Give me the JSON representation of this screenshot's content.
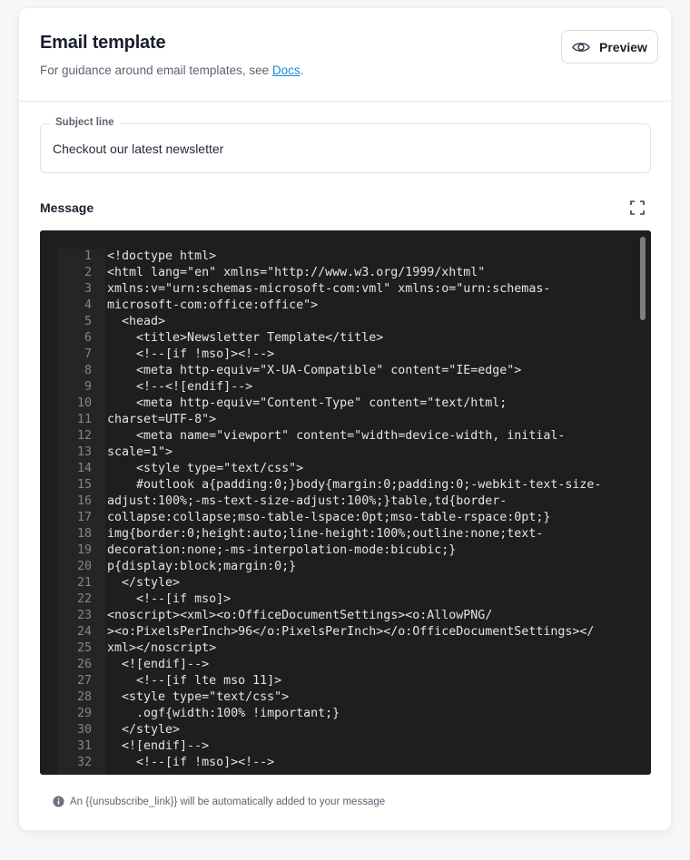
{
  "header": {
    "title": "Email template",
    "subtitle_prefix": "For guidance around email templates, see ",
    "docs_link": "Docs",
    "subtitle_suffix": "."
  },
  "preview_button": {
    "label": "Preview",
    "icon": "eye-icon"
  },
  "subject": {
    "label": "Subject line",
    "value": "Checkout our latest newsletter"
  },
  "message": {
    "label": "Message",
    "expand_icon": "expand-icon"
  },
  "editor": {
    "lines": [
      {
        "n": "1",
        "t": "<!doctype html>"
      },
      {
        "n": "2",
        "t": "<html lang=\"en\" xmlns=\"http://www.w3.org/1999/xhtml\""
      },
      {
        "n": "3",
        "t": "xmlns:v=\"urn:schemas-microsoft-com:vml\" xmlns:o=\"urn:schemas-"
      },
      {
        "n": "4",
        "t": "microsoft-com:office:office\">"
      },
      {
        "n": "5",
        "t": "  <head>"
      },
      {
        "n": "6",
        "t": "    <title>Newsletter Template</title>"
      },
      {
        "n": "7",
        "t": "    <!--[if !mso]><!-->"
      },
      {
        "n": "8",
        "t": "    <meta http-equiv=\"X-UA-Compatible\" content=\"IE=edge\">"
      },
      {
        "n": "9",
        "t": "    <!--<![endif]-->"
      },
      {
        "n": "10",
        "t": "    <meta http-equiv=\"Content-Type\" content=\"text/html;"
      },
      {
        "n": "11",
        "t": "charset=UTF-8\">"
      },
      {
        "n": "12",
        "t": "    <meta name=\"viewport\" content=\"width=device-width, initial-"
      },
      {
        "n": "13",
        "t": "scale=1\">"
      },
      {
        "n": "14",
        "t": "    <style type=\"text/css\">"
      },
      {
        "n": "15",
        "t": "    #outlook a{padding:0;}body{margin:0;padding:0;-webkit-text-size-"
      },
      {
        "n": "16",
        "t": "adjust:100%;-ms-text-size-adjust:100%;}table,td{border-"
      },
      {
        "n": "17",
        "t": "collapse:collapse;mso-table-lspace:0pt;mso-table-rspace:0pt;}"
      },
      {
        "n": "18",
        "t": "img{border:0;height:auto;line-height:100%;outline:none;text-"
      },
      {
        "n": "19",
        "t": "decoration:none;-ms-interpolation-mode:bicubic;}"
      },
      {
        "n": "20",
        "t": "p{display:block;margin:0;}"
      },
      {
        "n": "21",
        "t": "  </style>"
      },
      {
        "n": "22",
        "t": "    <!--[if mso]>"
      },
      {
        "n": "23",
        "t": "<noscript><xml><o:OfficeDocumentSettings><o:AllowPNG/"
      },
      {
        "n": "24",
        "t": "><o:PixelsPerInch>96</o:PixelsPerInch></o:OfficeDocumentSettings></"
      },
      {
        "n": "25",
        "t": "xml></noscript>"
      },
      {
        "n": "26",
        "t": "  <![endif]-->"
      },
      {
        "n": "27",
        "t": "    <!--[if lte mso 11]>"
      },
      {
        "n": "28",
        "t": "  <style type=\"text/css\">"
      },
      {
        "n": "29",
        "t": "    .ogf{width:100% !important;}"
      },
      {
        "n": "30",
        "t": "  </style>"
      },
      {
        "n": "31",
        "t": "  <![endif]-->"
      },
      {
        "n": "32",
        "t": "    <!--[if !mso]><!-->"
      }
    ]
  },
  "hint": {
    "icon": "info-icon",
    "text": "An {{unsubscribe_link}} will be automatically added to your message"
  }
}
